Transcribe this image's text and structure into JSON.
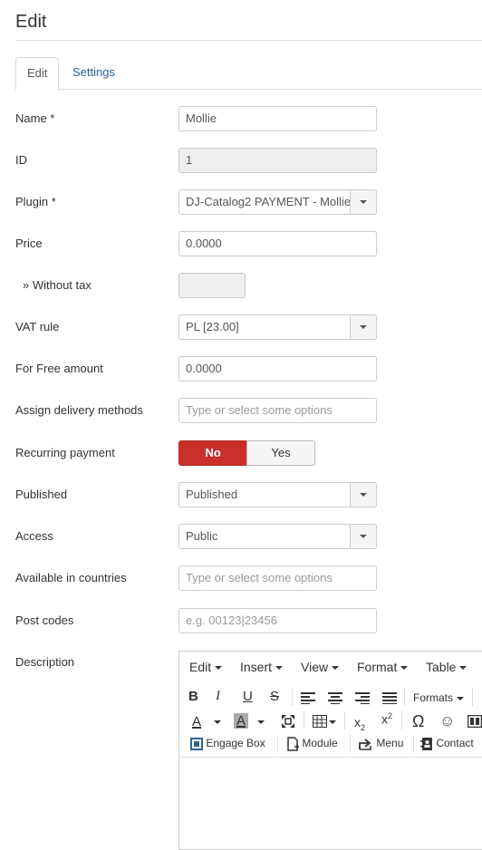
{
  "page": {
    "title": "Edit"
  },
  "tabs": [
    {
      "label": "Edit"
    },
    {
      "label": "Settings"
    }
  ],
  "form": {
    "name": {
      "label": "Name *",
      "value": "Mollie"
    },
    "id": {
      "label": "ID",
      "value": "1"
    },
    "plugin": {
      "label": "Plugin *",
      "value": "DJ-Catalog2 PAYMENT - Mollie"
    },
    "price": {
      "label": "Price",
      "value": "0.0000"
    },
    "without_tax": {
      "label": "» Without tax",
      "value": ""
    },
    "vat_rule": {
      "label": "VAT rule",
      "value": "PL [23.00]"
    },
    "free_amount": {
      "label": "For Free amount",
      "value": "0.0000"
    },
    "delivery": {
      "label": "Assign delivery methods",
      "placeholder": "Type or select some options"
    },
    "recurring": {
      "label": "Recurring payment",
      "no": "No",
      "yes": "Yes",
      "selected": "No"
    },
    "published": {
      "label": "Published",
      "value": "Published"
    },
    "access": {
      "label": "Access",
      "value": "Public"
    },
    "countries": {
      "label": "Available in countries",
      "placeholder": "Type or select some options"
    },
    "postcodes": {
      "label": "Post codes",
      "placeholder": "e.g. 00123|23456"
    },
    "description": {
      "label": "Description"
    }
  },
  "editor": {
    "menu": [
      "Edit",
      "Insert",
      "View",
      "Format",
      "Table"
    ],
    "formats_label": "Formats",
    "plugin_buttons": [
      "Engage Box",
      "Module",
      "Menu",
      "Contact"
    ]
  }
}
